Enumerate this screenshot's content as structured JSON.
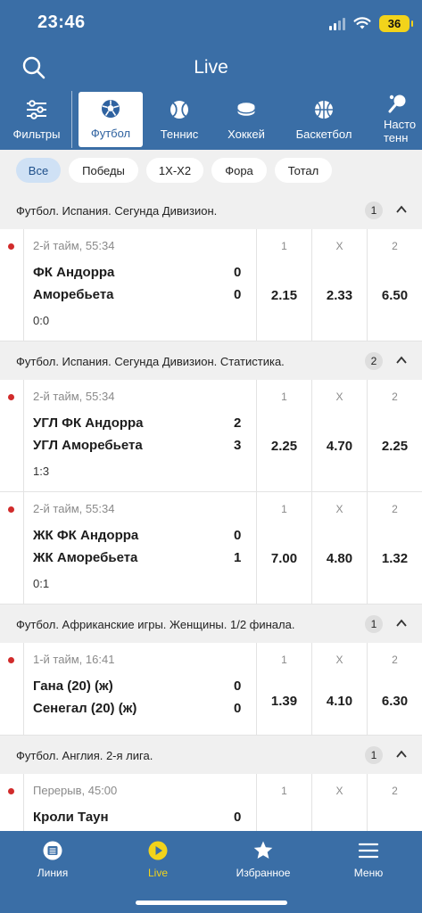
{
  "status": {
    "time": "23:46",
    "battery": "36"
  },
  "header": {
    "title": "Live"
  },
  "sports": [
    {
      "label": "Фильтры",
      "icon": "filters-icon"
    },
    {
      "label": "Футбол",
      "icon": "football-icon",
      "active": true
    },
    {
      "label": "Теннис",
      "icon": "tennis-icon"
    },
    {
      "label": "Хоккей",
      "icon": "hockey-icon"
    },
    {
      "label": "Баскетбол",
      "icon": "basketball-icon"
    },
    {
      "label": "Насто\nтенн",
      "icon": "table-tennis-icon"
    }
  ],
  "filters": [
    "Все",
    "Победы",
    "1X-X2",
    "Фора",
    "Тотал"
  ],
  "sections": [
    {
      "name": "Футбол. Испания. Сегунда Дивизион.",
      "count": "1",
      "matches": [
        {
          "time": "2-й тайм, 55:34",
          "team1": "ФК Андорра",
          "team2": "Аморебьета",
          "score1": "0",
          "score2": "0",
          "result": "0:0",
          "odds": [
            {
              "label": "1",
              "value": "2.15"
            },
            {
              "label": "X",
              "value": "2.33"
            },
            {
              "label": "2",
              "value": "6.50"
            }
          ]
        }
      ]
    },
    {
      "name": "Футбол. Испания. Сегунда Дивизион. Статистика.",
      "count": "2",
      "matches": [
        {
          "time": "2-й тайм, 55:34",
          "team1": "УГЛ ФК Андорра",
          "team2": "УГЛ Аморебьета",
          "score1": "2",
          "score2": "3",
          "result": "1:3",
          "odds": [
            {
              "label": "1",
              "value": "2.25"
            },
            {
              "label": "X",
              "value": "4.70"
            },
            {
              "label": "2",
              "value": "2.25"
            }
          ]
        },
        {
          "time": "2-й тайм, 55:34",
          "team1": "ЖК ФК Андорра",
          "team2": "ЖК Аморебьета",
          "score1": "0",
          "score2": "1",
          "result": "0:1",
          "odds": [
            {
              "label": "1",
              "value": "7.00"
            },
            {
              "label": "X",
              "value": "4.80"
            },
            {
              "label": "2",
              "value": "1.32"
            }
          ]
        }
      ]
    },
    {
      "name": "Футбол. Африканские игры. Женщины. 1/2 финала.",
      "count": "1",
      "matches": [
        {
          "time": "1-й тайм, 16:41",
          "team1": "Гана (20) (ж)",
          "team2": "Сенегал (20) (ж)",
          "score1": "0",
          "score2": "0",
          "result": "",
          "odds": [
            {
              "label": "1",
              "value": "1.39"
            },
            {
              "label": "X",
              "value": "4.10"
            },
            {
              "label": "2",
              "value": "6.30"
            }
          ]
        }
      ]
    },
    {
      "name": "Футбол. Англия. 2-я лига.",
      "count": "1",
      "matches": [
        {
          "time": "Перерыв, 45:00",
          "team1": "Кроли Таун",
          "team2": "",
          "score1": "0",
          "score2": "",
          "result": "",
          "odds": [
            {
              "label": "1",
              "value": ""
            },
            {
              "label": "X",
              "value": ""
            },
            {
              "label": "2",
              "value": ""
            }
          ]
        }
      ]
    }
  ],
  "nav": [
    {
      "label": "Линия",
      "icon": "line-icon"
    },
    {
      "label": "Live",
      "icon": "live-play-icon",
      "active": true
    },
    {
      "label": "Избранное",
      "icon": "star-icon"
    },
    {
      "label": "Меню",
      "icon": "menu-icon"
    }
  ],
  "colors": {
    "primary": "#3a6ea6",
    "accent": "#f2d31b",
    "live": "#d12b2b"
  }
}
